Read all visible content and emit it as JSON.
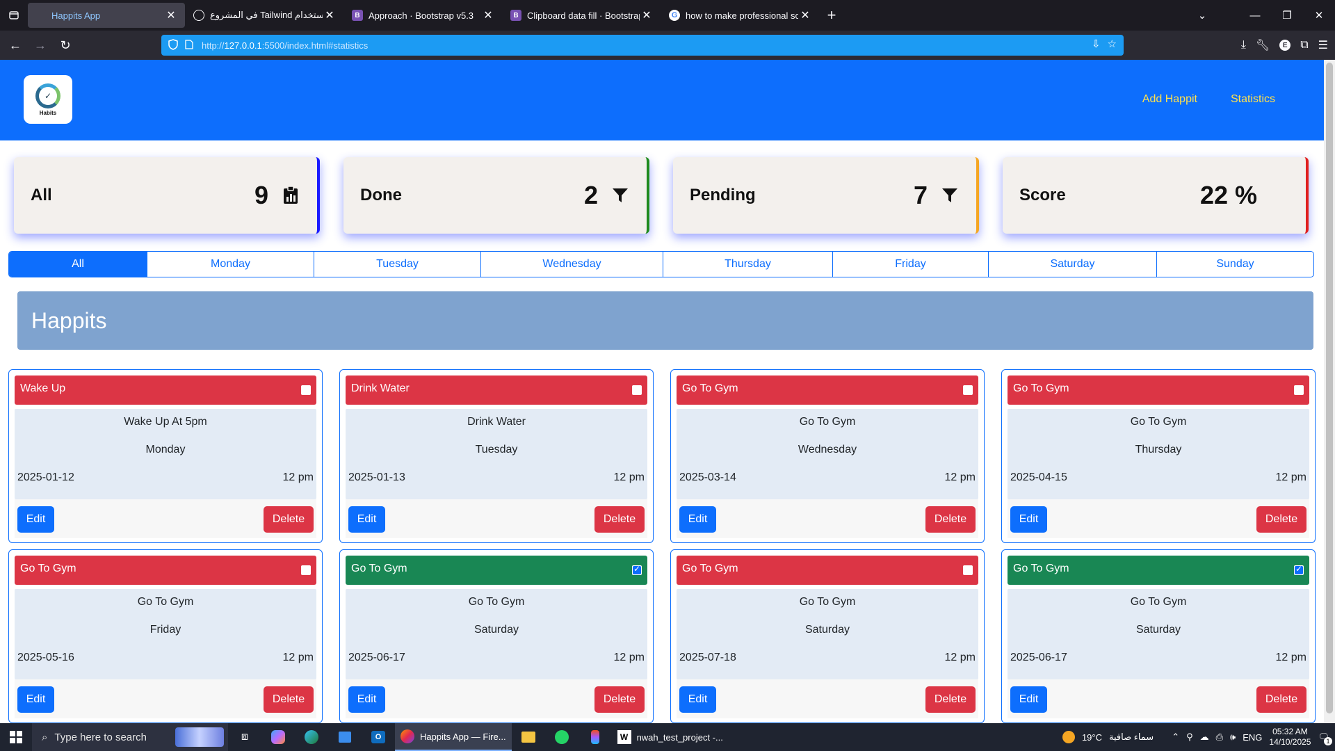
{
  "browser": {
    "tabs": [
      {
        "title": "Happits App",
        "active": true,
        "favicon": "page-icon"
      },
      {
        "title": "في المشروع Tailwind استخدام",
        "active": false,
        "favicon": "openai-icon"
      },
      {
        "title": "Approach · Bootstrap v5.3",
        "active": false,
        "favicon": "bootstrap-icon"
      },
      {
        "title": "Clipboard data fill · Bootstrap Ic",
        "active": false,
        "favicon": "bootstrap-icon"
      },
      {
        "title": "how to make professional scree",
        "active": false,
        "favicon": "google-icon"
      }
    ],
    "url_prefix": "http://",
    "url_host": "127.0.0.1",
    "url_rest": ":5500/index.html#statistics"
  },
  "app": {
    "logo_text": "Habits",
    "nav": {
      "add": "Add Happit",
      "stats": "Statistics"
    },
    "stats": [
      {
        "label": "All",
        "value": "9",
        "icon": "clipboard-data-icon",
        "accent": "#1a1aff"
      },
      {
        "label": "Done",
        "value": "2",
        "icon": "funnel-icon",
        "accent": "#1e8a1e"
      },
      {
        "label": "Pending",
        "value": "7",
        "icon": "funnel-icon",
        "accent": "#f5a623"
      },
      {
        "label": "Score",
        "value": "22 %",
        "icon": "",
        "accent": "#e0201f"
      }
    ],
    "days": [
      "All",
      "Monday",
      "Tuesday",
      "Wednesday",
      "Thursday",
      "Friday",
      "Saturday",
      "Sunday"
    ],
    "active_day": "All",
    "banner_title": "Happits",
    "cards": [
      {
        "title": "Wake Up",
        "desc": "Wake Up At 5pm",
        "day": "Monday",
        "date": "2025-01-12",
        "time": "12 pm",
        "done": false
      },
      {
        "title": "Drink Water",
        "desc": "Drink Water",
        "day": "Tuesday",
        "date": "2025-01-13",
        "time": "12 pm",
        "done": false
      },
      {
        "title": "Go To Gym",
        "desc": "Go To Gym",
        "day": "Wednesday",
        "date": "2025-03-14",
        "time": "12 pm",
        "done": false
      },
      {
        "title": "Go To Gym",
        "desc": "Go To Gym",
        "day": "Thursday",
        "date": "2025-04-15",
        "time": "12 pm",
        "done": false
      },
      {
        "title": "Go To Gym",
        "desc": "Go To Gym",
        "day": "Friday",
        "date": "2025-05-16",
        "time": "12 pm",
        "done": false
      },
      {
        "title": "Go To Gym",
        "desc": "Go To Gym",
        "day": "Saturday",
        "date": "2025-06-17",
        "time": "12 pm",
        "done": true
      },
      {
        "title": "Go To Gym",
        "desc": "Go To Gym",
        "day": "Saturday",
        "date": "2025-07-18",
        "time": "12 pm",
        "done": false
      },
      {
        "title": "Go To Gym",
        "desc": "Go To Gym",
        "day": "Saturday",
        "date": "2025-06-17",
        "time": "12 pm",
        "done": true
      }
    ],
    "edit_label": "Edit",
    "delete_label": "Delete"
  },
  "taskbar": {
    "search_placeholder": "Type here to search",
    "apps": [
      {
        "label": "Happits App — Fire...",
        "active": true
      },
      {
        "label": "nwah_test_project -...",
        "active": false
      }
    ],
    "weather_temp": "19°C",
    "weather_desc": "سماء صافية",
    "lang": "ENG",
    "time": "05:32 AM",
    "date": "14/10/2025",
    "notif_count": "1"
  }
}
